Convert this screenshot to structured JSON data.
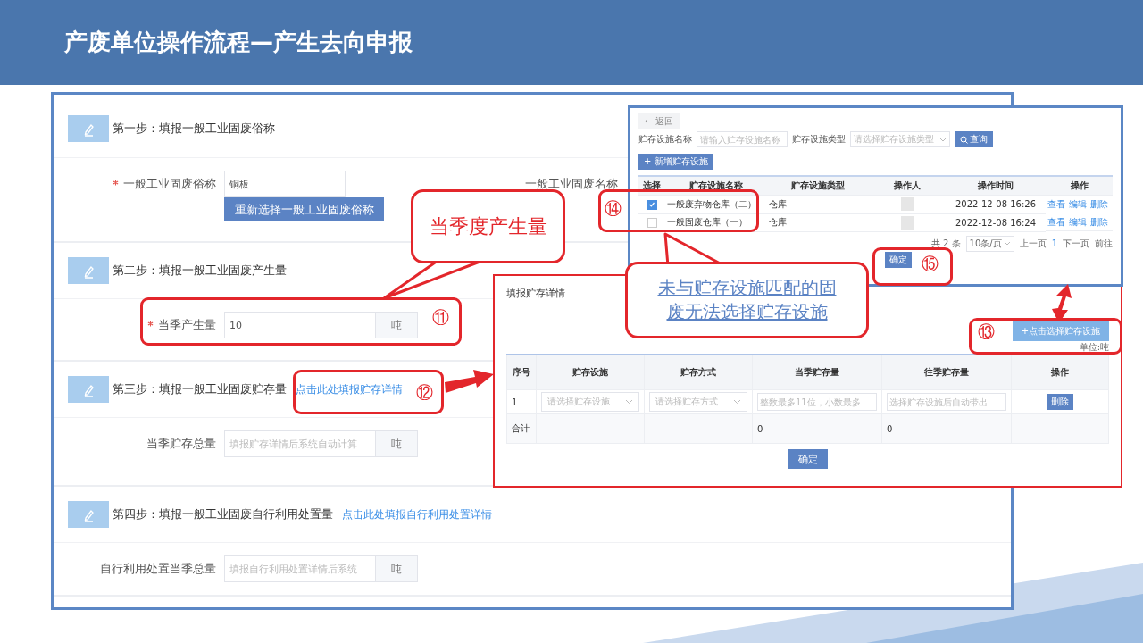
{
  "header": {
    "title": "产废单位操作流程—产生去向申报"
  },
  "steps": [
    {
      "title": "第一步：填报一般工业固废俗称",
      "fields": [
        {
          "label": "一般工业固废俗称",
          "required": true,
          "value": "铜板",
          "button": "重新选择一般工业固废俗称"
        },
        {
          "label": "一般工业固废名称",
          "required": false
        }
      ]
    },
    {
      "title": "第二步：填报一般工业固废产生量",
      "fields": [
        {
          "label": "当季产生量",
          "required": true,
          "value": "10",
          "unit": "吨"
        }
      ]
    },
    {
      "title": "第三步：填报一般工业固废贮存量",
      "link": "点击此处填报贮存详情",
      "fields": [
        {
          "label": "当季贮存总量",
          "required": false,
          "placeholder": "填报贮存详情后系统自动计算",
          "unit": "吨"
        }
      ]
    },
    {
      "title": "第四步：填报一般工业固废自行利用处置量",
      "link": "点击此处填报自行利用处置详情",
      "fields": [
        {
          "label": "自行利用处置当季总量",
          "required": false,
          "placeholder": "填报自行利用处置详情后系统",
          "unit": "吨"
        }
      ]
    }
  ],
  "storage_window": {
    "back": "← 返回",
    "filters": [
      {
        "label": "贮存设施名称",
        "placeholder": "请输入贮存设施名称",
        "kind": "text"
      },
      {
        "label": "贮存设施类型",
        "placeholder": "请选择贮存设施类型",
        "kind": "select"
      }
    ],
    "search": "查询",
    "add": "+ 新增贮存设施",
    "columns": [
      "选择",
      "贮存设施名称",
      "贮存设施类型",
      "操作人",
      "操作时间",
      "操作"
    ],
    "rows": [
      {
        "checked": true,
        "name": "一般废弃物仓库（二）",
        "type": "仓库",
        "time": "2022-12-08 16:26",
        "actions": [
          "查看",
          "编辑",
          "删除"
        ]
      },
      {
        "checked": false,
        "name": "一般固废仓库（一）",
        "type": "仓库",
        "time": "2022-12-08 16:24",
        "actions": [
          "查看",
          "编辑",
          "删除"
        ]
      }
    ],
    "pagination": {
      "total": "共 2 条",
      "page_size": "10条/页",
      "prev": "上一页",
      "page": "1",
      "next": "下一页",
      "goto": "前往"
    },
    "confirm": "确定"
  },
  "detail_panel": {
    "title": "填报贮存详情",
    "select_button": "+点击选择贮存设施",
    "unit": "单位:吨",
    "columns": [
      "序号",
      "贮存设施",
      "贮存方式",
      "当季贮存量",
      "往季贮存量",
      "操作"
    ],
    "rows": [
      {
        "kind": "entry",
        "cells": [
          {
            "kind": "text",
            "text": "1"
          },
          {
            "kind": "select",
            "placeholder": "请选择贮存设施"
          },
          {
            "kind": "select",
            "placeholder": "请选择贮存方式"
          },
          {
            "kind": "input",
            "placeholder": "整数最多11位，小数最多"
          },
          {
            "kind": "input",
            "placeholder": "选择贮存设施后自动带出"
          },
          {
            "kind": "button",
            "text": "删除"
          }
        ]
      },
      {
        "kind": "total",
        "cells": [
          {
            "kind": "text",
            "text": "合计"
          },
          {
            "kind": "empty"
          },
          {
            "kind": "empty"
          },
          {
            "kind": "text",
            "text": "0"
          },
          {
            "kind": "text",
            "text": "0"
          },
          {
            "kind": "empty"
          }
        ]
      }
    ],
    "confirm": "确定"
  },
  "quantity_callout": {
    "text": "当季度产生量"
  },
  "notice_callout": {
    "text": "未与贮存设施匹配的固废无法选择贮存设施"
  },
  "markers": [
    "⑪",
    "⑫",
    "⑬",
    "⑭",
    "⑮"
  ]
}
